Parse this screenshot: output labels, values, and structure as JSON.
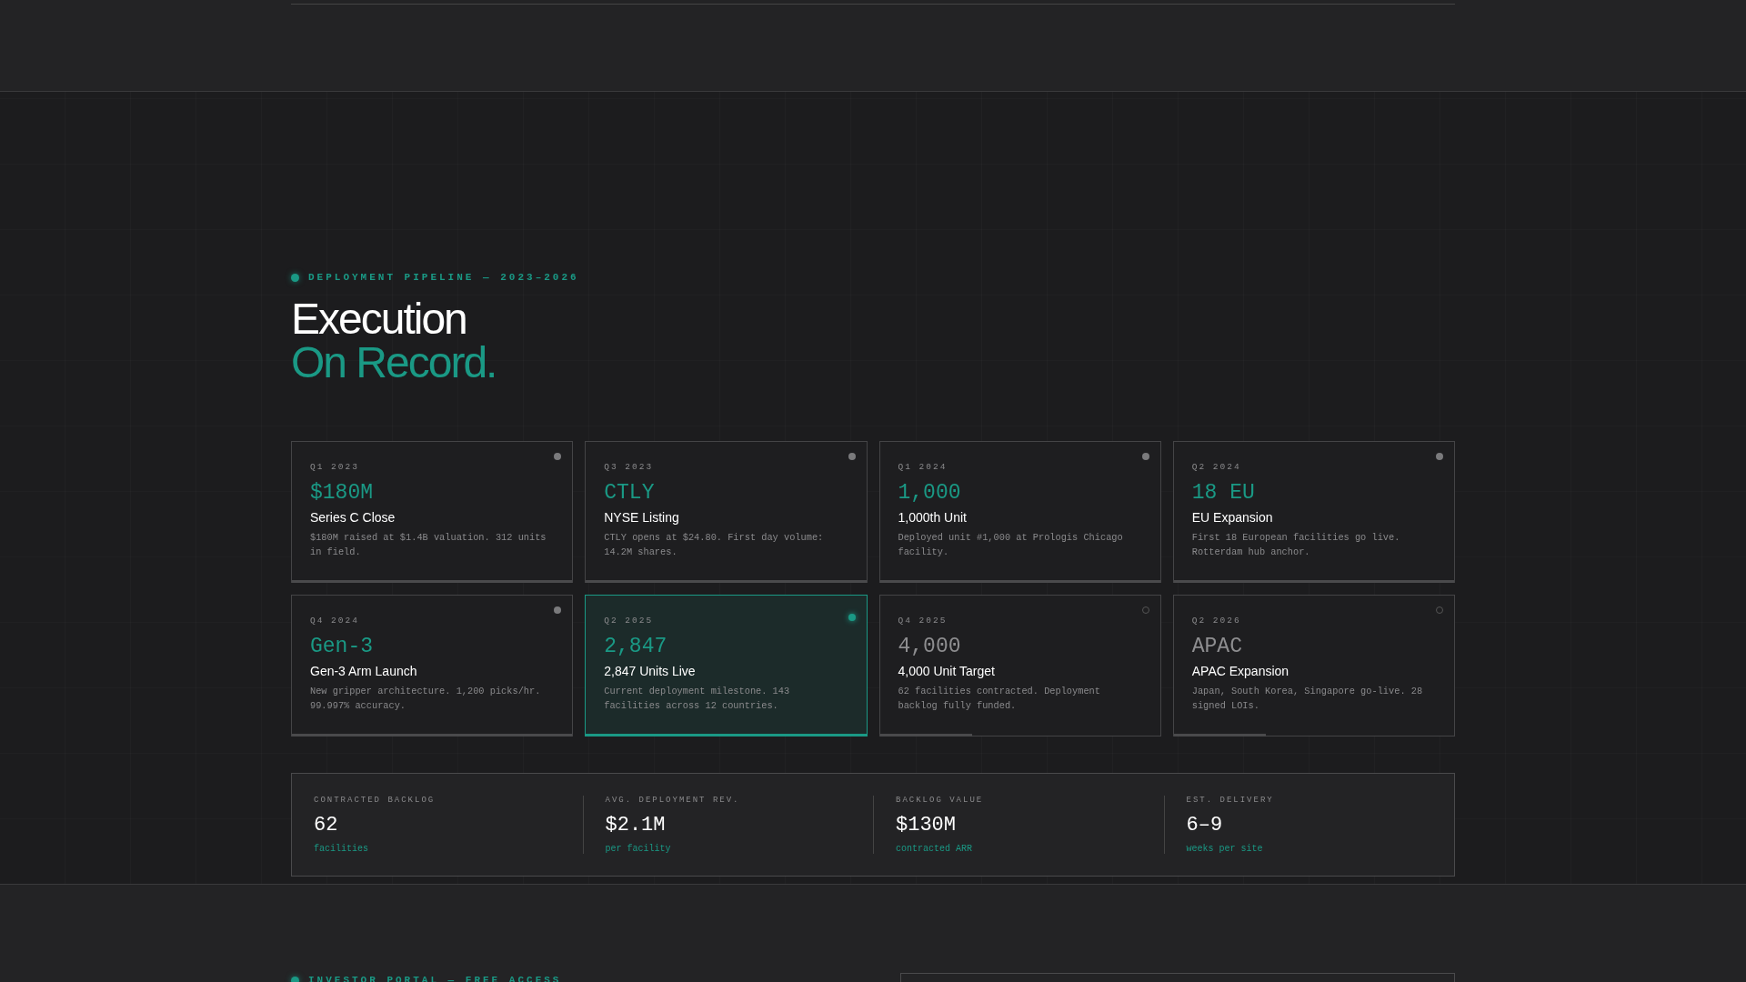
{
  "section": {
    "eyebrow": "DEPLOYMENT PIPELINE — 2023–2026",
    "title_line_1": "Execution",
    "title_line_2": "On Record."
  },
  "milestones": [
    {
      "quarter": "Q1 2023",
      "value": "$180M",
      "title": "Series C Close",
      "description": "$180M raised at $1.4B valuation. 312 units in field.",
      "kind": "done",
      "level": 1
    },
    {
      "quarter": "Q3 2023",
      "value": "CTLY",
      "title": "NYSE Listing",
      "description": "CTLY opens at $24.80. First day volume: 14.2M shares.",
      "kind": "done",
      "level": 1
    },
    {
      "quarter": "Q1 2024",
      "value": "1,000",
      "title": "1,000th Unit",
      "description": "Deployed unit #1,000 at Prologis Chicago facility.",
      "kind": "done",
      "level": 1
    },
    {
      "quarter": "Q2 2024",
      "value": "18 EU",
      "title": "EU Expansion",
      "description": "First 18 European facilities go live. Rotterdam hub anchor.",
      "kind": "done",
      "level": 1
    },
    {
      "quarter": "Q4 2024",
      "value": "Gen-3",
      "title": "Gen-3 Arm Launch",
      "description": "New gripper architecture. 1,200 picks/hr. 99.997% accuracy.",
      "kind": "done",
      "level": 1
    },
    {
      "quarter": "Q2 2025",
      "value": "2,847",
      "title": "2,847 Units Live",
      "description": "Current deployment milestone. 143 facilities across 12 countries.",
      "kind": "current",
      "level": 1
    },
    {
      "quarter": "Q4 2025",
      "value": "4,000",
      "title": "4,000 Unit Target",
      "description": "62 facilities contracted. Deployment backlog fully funded.",
      "kind": "upcoming",
      "level": 0.33
    },
    {
      "quarter": "Q2 2026",
      "value": "APAC",
      "title": "APAC Expansion",
      "description": "Japan, South Korea, Singapore go-live. 28 signed LOIs.",
      "kind": "upcoming",
      "level": 0.33
    }
  ],
  "stats": [
    {
      "label": "CONTRACTED BACKLOG",
      "value": "62",
      "sub": "facilities"
    },
    {
      "label": "AVG. DEPLOYMENT REV.",
      "value": "$2.1M",
      "sub": "per facility"
    },
    {
      "label": "BACKLOG VALUE",
      "value": "$130M",
      "sub": "contracted ARR"
    },
    {
      "label": "EST. DELIVERY",
      "value": "6–9",
      "sub": "weeks per site"
    }
  ],
  "next_section": {
    "eyebrow": "INVESTOR PORTAL — FREE ACCESS"
  }
}
